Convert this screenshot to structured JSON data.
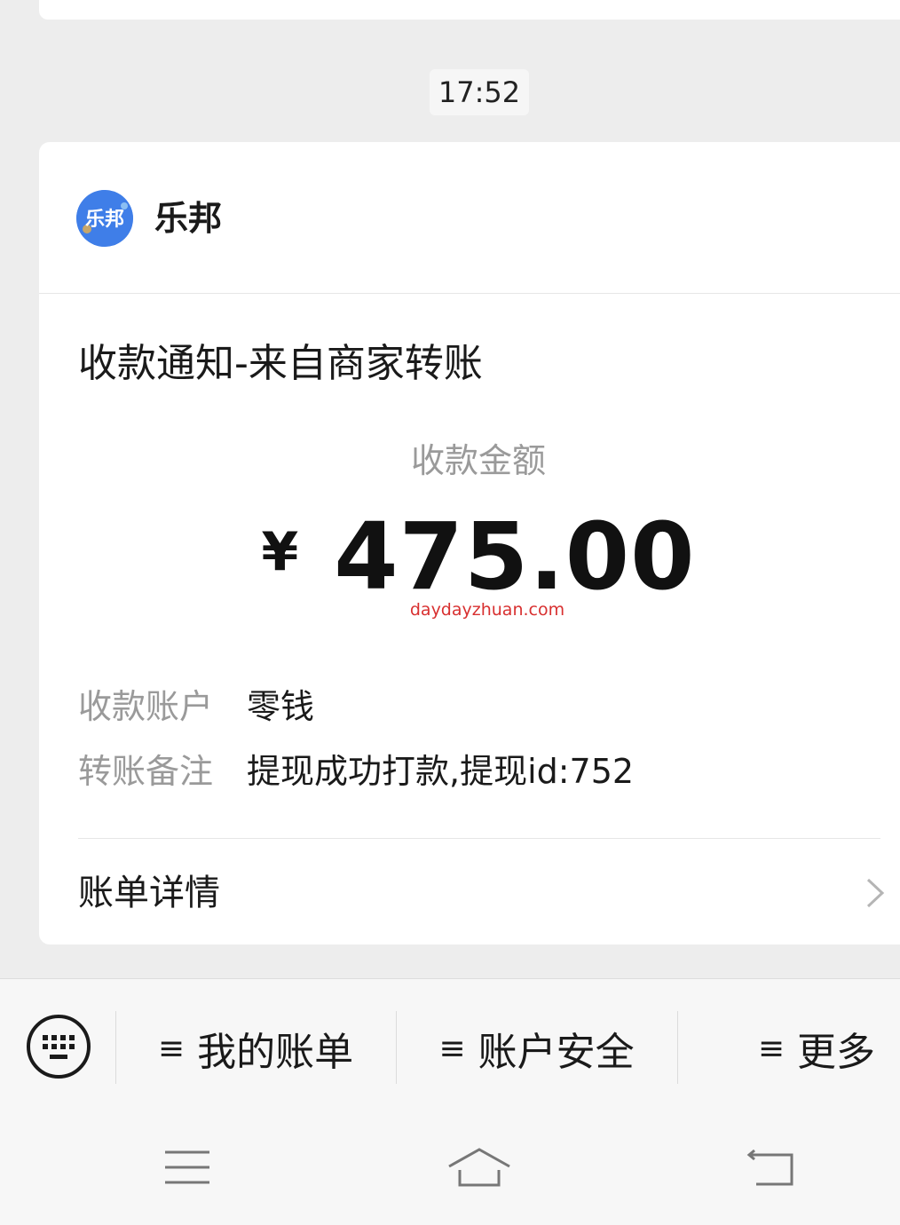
{
  "chat": {
    "timestamp": "17:52"
  },
  "card": {
    "merchant": {
      "name": "乐邦",
      "avatar_text": "乐邦",
      "avatar_color": "#3f7ee8"
    },
    "title": "收款通知-来自商家转账",
    "amount_label": "收款金额",
    "currency_symbol": "¥",
    "amount": "475.00",
    "watermark": "daydayzhuan.com",
    "details": [
      {
        "label": "收款账户",
        "value": "零钱"
      },
      {
        "label": "转账备注",
        "value": "提现成功打款,提现id:752"
      }
    ],
    "bill_detail_label": "账单详情",
    "bill_detail_icon": "chevron-right-icon"
  },
  "menu": {
    "keyboard_icon": "keyboard-icon",
    "items": [
      {
        "label": "我的账单",
        "icon": "≡"
      },
      {
        "label": "账户安全",
        "icon": "≡"
      },
      {
        "label": "更多",
        "icon": "≡"
      }
    ]
  },
  "system_nav": {
    "icons": [
      "menu-icon",
      "home-icon",
      "back-icon"
    ]
  }
}
